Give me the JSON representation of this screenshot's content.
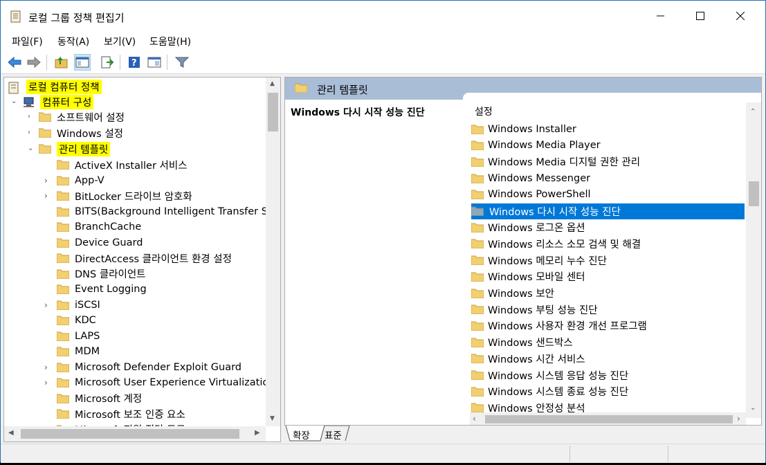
{
  "window": {
    "title": "로컬 그룹 정책 편집기"
  },
  "menu": [
    "파일(F)",
    "동작(A)",
    "보기(V)",
    "도움말(H)"
  ],
  "toolbar": {
    "icons": [
      "back-icon",
      "forward-icon",
      "up-folder-icon",
      "show-hide-tree-icon",
      "export-list-icon",
      "help-icon",
      "properties-icon",
      "filter-icon"
    ]
  },
  "tree": {
    "root": "로컬 컴퓨터 정책",
    "computer_config": "컴퓨터 구성",
    "software_settings": "소프트웨어 설정",
    "windows_settings": "Windows 설정",
    "admin_templates": "관리 템플릿",
    "children": [
      "ActiveX Installer 서비스",
      "App-V",
      "BitLocker 드라이브 암호화",
      "BITS(Background Intelligent Transfer Servi",
      "BranchCache",
      "Device Guard",
      "DirectAccess 클라이언트 환경 설정",
      "DNS 클라이언트",
      "Event Logging",
      "iSCSI",
      "KDC",
      "LAPS",
      "MDM",
      "Microsoft Defender Exploit Guard",
      "Microsoft User Experience Virtualization",
      "Microsoft 계정",
      "Microsoft 보조 인증 요소",
      "Microsoft 지원 진단 도구"
    ]
  },
  "right": {
    "header": "관리 템플릿",
    "description_title": "Windows 다시 시작 성능 진단",
    "column_header": "설정",
    "items": [
      "Windows Installer",
      "Windows Media Player",
      "Windows Media 디지털 권한 관리",
      "Windows Messenger",
      "Windows PowerShell",
      "Windows 다시 시작 성능 진단",
      "Windows 로그온 옵션",
      "Windows 리소스 소모 검색 및 해결",
      "Windows 메모리 누수 진단",
      "Windows 모바일 센터",
      "Windows 보안",
      "Windows 부팅 성능 진단",
      "Windows 사용자 환경 개선 프로그램",
      "Windows 샌드박스",
      "Windows 시간 서비스",
      "Windows 시스템 응답 성능 진단",
      "Windows 시스템 종료 성능 진단",
      "Windows 안정성 분석"
    ],
    "selected": "Windows 다시 시작 성능 진단"
  },
  "tabs": [
    "확장",
    "표준"
  ],
  "colors": {
    "highlight": "#ffff00",
    "selection": "#0078d7",
    "header": "#a9bdd6"
  }
}
